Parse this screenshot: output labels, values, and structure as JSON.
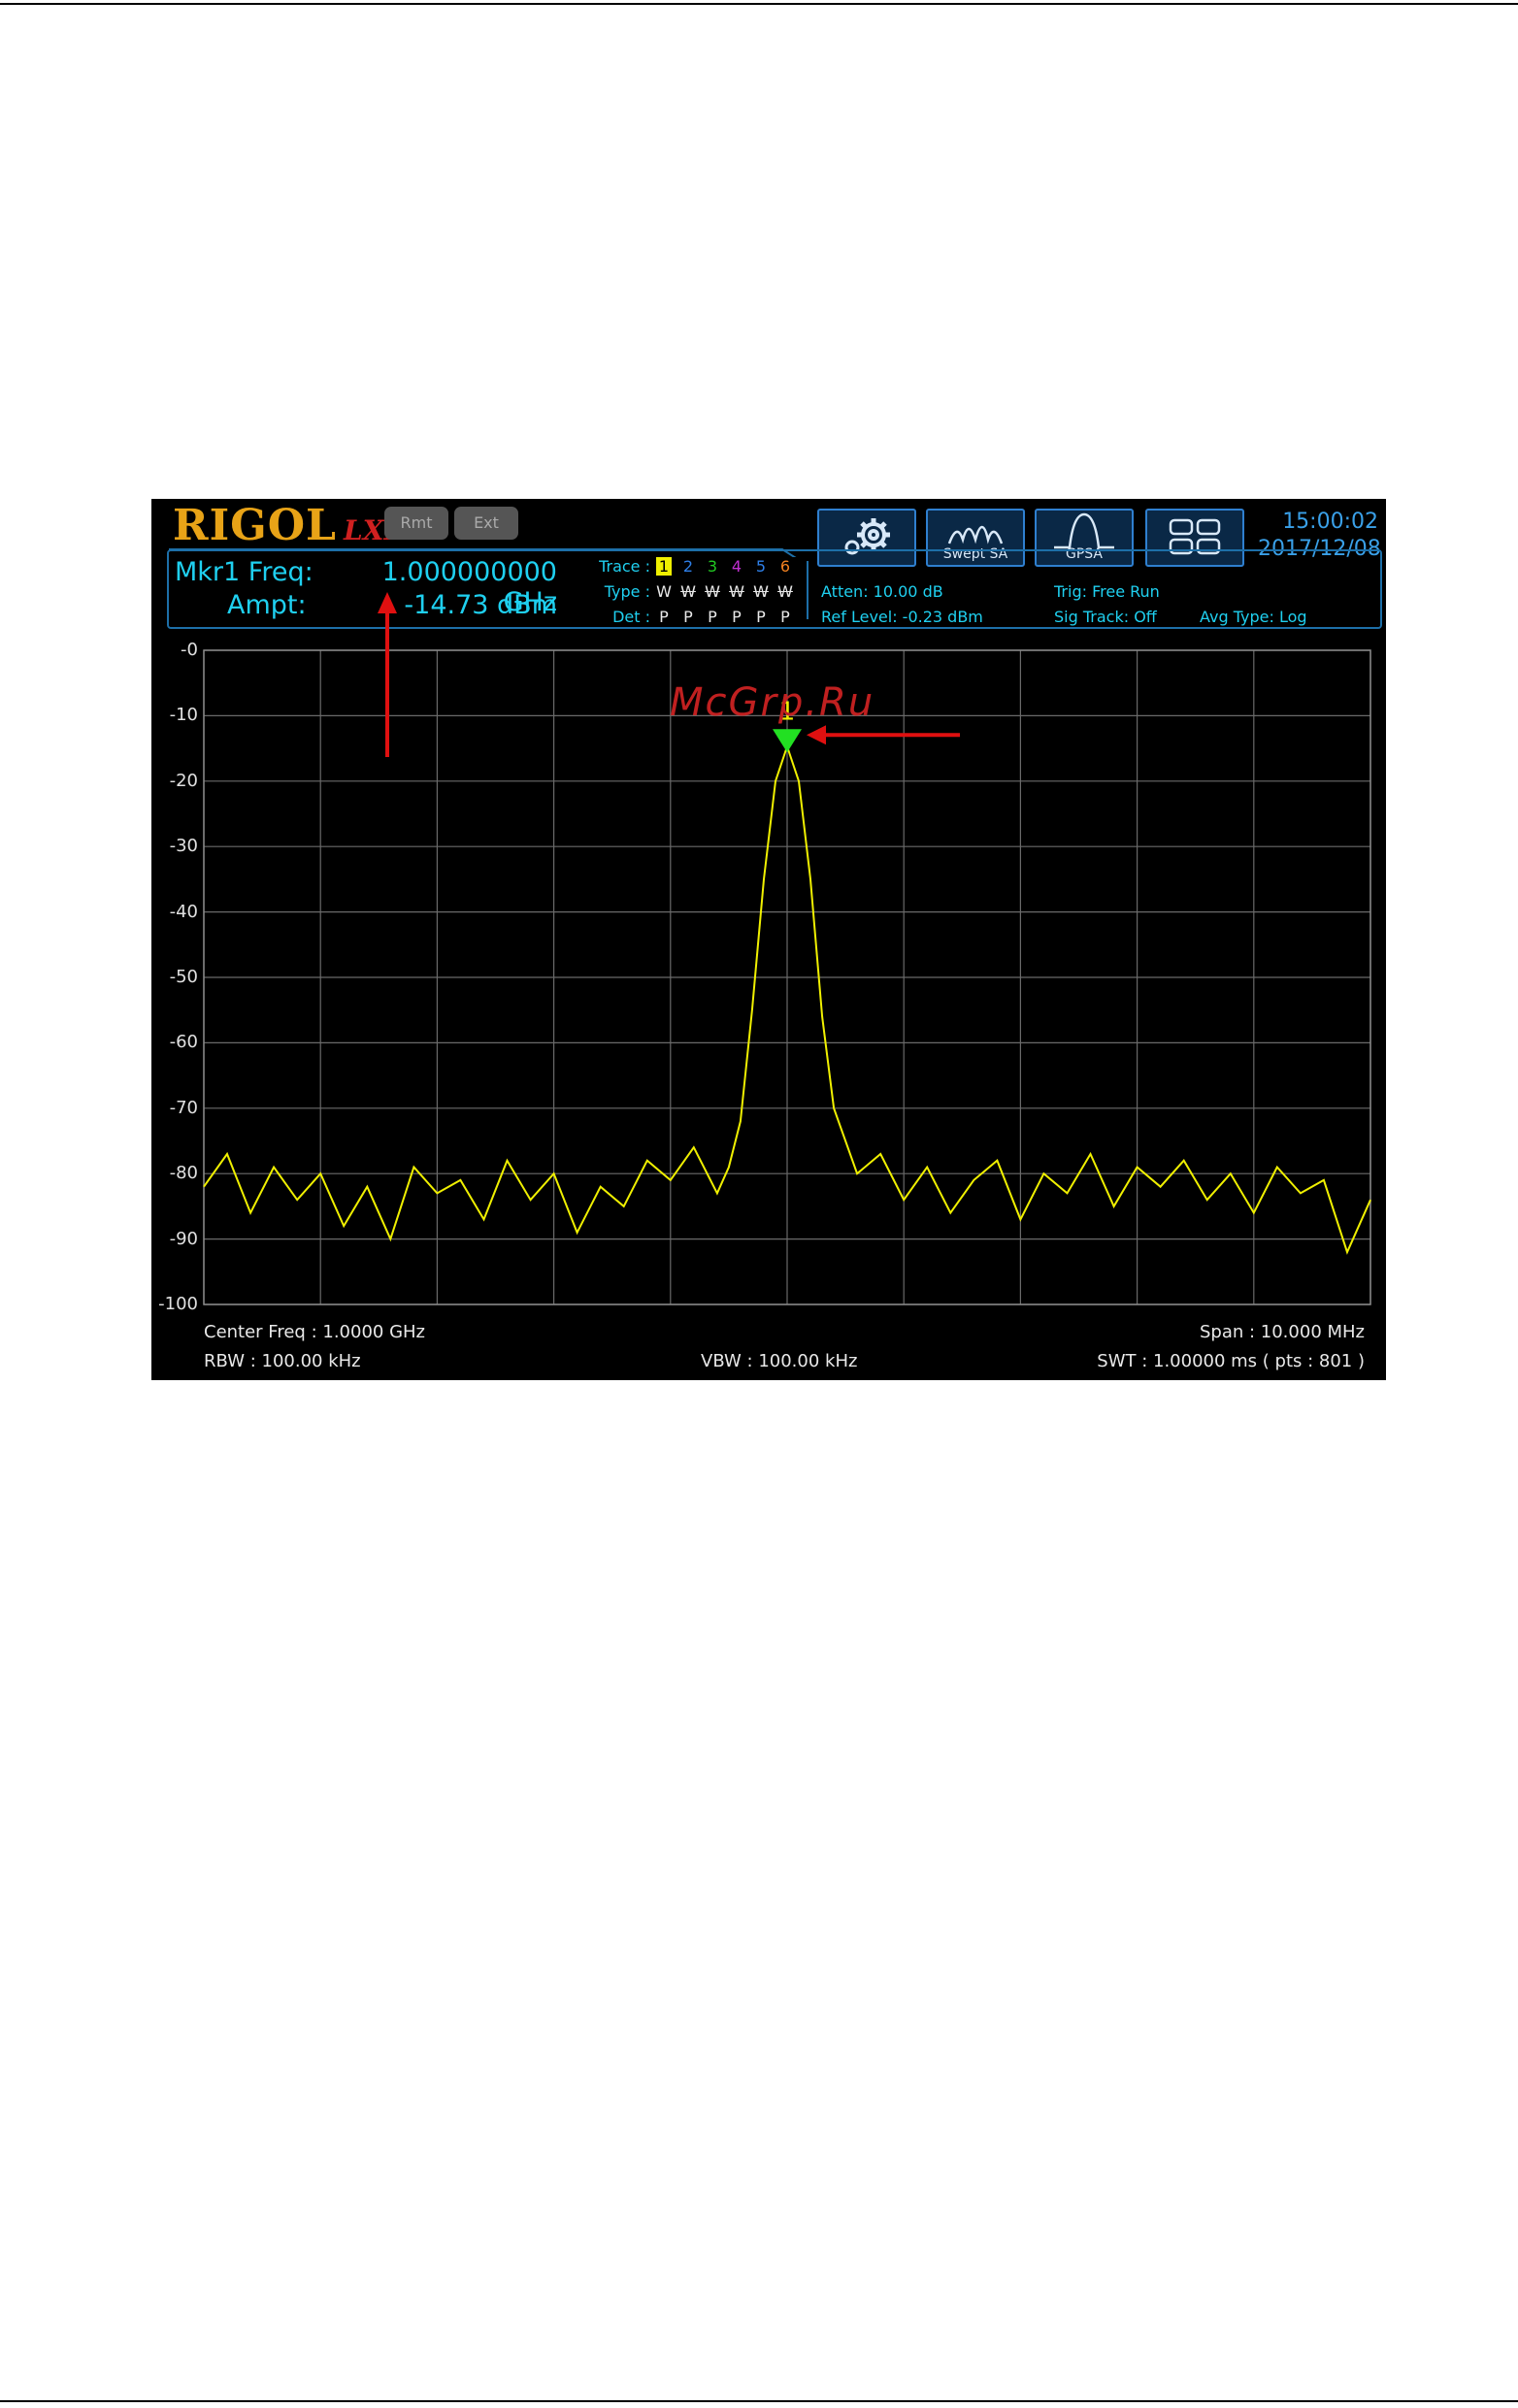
{
  "header": {
    "logo": "RIGOL",
    "logo_suffix": "LXI",
    "rmt_label": "Rmt",
    "ext_label": "Ext",
    "icons": [
      "gear-icon",
      "swept-sa-icon",
      "gpsa-icon",
      "layout-grid-icon"
    ],
    "swept_sa_label": "Swept SA",
    "gpsa_label": "GPSA",
    "time": "15:00:02",
    "date": "2017/12/08"
  },
  "marker": {
    "freq_label": "Mkr1 Freq:",
    "freq_value": "1.000000000 GHz",
    "ampt_label": "Ampt:",
    "ampt_value": "-14.73 dBm",
    "number": "1"
  },
  "traces": {
    "trace_label": "Trace :",
    "type_label": "Type :",
    "det_label": "Det :",
    "numbers": [
      "1",
      "2",
      "3",
      "4",
      "5",
      "6"
    ],
    "colors": [
      "#f0f000",
      "#2e7fe8",
      "#22c822",
      "#c02fd0",
      "#2e7fe8",
      "#f08020"
    ],
    "types": [
      "W",
      "W",
      "W",
      "W",
      "W",
      "W"
    ],
    "dets": [
      "P",
      "P",
      "P",
      "P",
      "P",
      "P"
    ]
  },
  "settings": {
    "atten": "Atten: 10.00 dB",
    "ref_level": "Ref Level: -0.23 dBm",
    "trig": "Trig: Free Run",
    "sig_track": "Sig Track: Off",
    "avg_type": "Avg Type: Log"
  },
  "footer": {
    "center_freq": "Center Freq : 1.0000 GHz",
    "span": "Span : 10.000 MHz",
    "rbw": "RBW : 100.00 kHz",
    "vbw": "VBW : 100.00 kHz",
    "swt": "SWT : 1.00000 ms ( pts : 801 )"
  },
  "watermark": "McGrp.Ru",
  "chart_data": {
    "type": "line",
    "x_range": [
      0.995,
      1.005
    ],
    "xlabel": "",
    "ylabel": "",
    "ylim": [
      -100,
      0
    ],
    "y_ticks": [
      "-0",
      "-10",
      "-20",
      "-30",
      "-40",
      "-50",
      "-60",
      "-70",
      "-80",
      "-90",
      "-100"
    ],
    "grid": true,
    "series": [
      {
        "color": "#f0f000",
        "x": [
          0.995,
          0.9952,
          0.9954,
          0.9956,
          0.9958,
          0.996,
          0.9962,
          0.9964,
          0.9966,
          0.9968,
          0.997,
          0.9972,
          0.9974,
          0.9976,
          0.9978,
          0.998,
          0.9982,
          0.9984,
          0.9986,
          0.9988,
          0.999,
          0.9992,
          0.9994,
          0.9995,
          0.9996,
          0.9997,
          0.9998,
          0.9999,
          1.0,
          1.0001,
          1.0002,
          1.0003,
          1.0004,
          1.0006,
          1.0008,
          1.001,
          1.0012,
          1.0014,
          1.0016,
          1.0018,
          1.002,
          1.0022,
          1.0024,
          1.0026,
          1.0028,
          1.003,
          1.0032,
          1.0034,
          1.0036,
          1.0038,
          1.004,
          1.0042,
          1.0044,
          1.0046,
          1.0048,
          1.005
        ],
        "values": [
          -82,
          -77,
          -86,
          -79,
          -84,
          -80,
          -88,
          -82,
          -90,
          -79,
          -83,
          -81,
          -87,
          -78,
          -84,
          -80,
          -89,
          -82,
          -85,
          -78,
          -81,
          -76,
          -83,
          -79,
          -72,
          -55,
          -35,
          -20,
          -14.7,
          -20,
          -35,
          -56,
          -70,
          -80,
          -77,
          -84,
          -79,
          -86,
          -81,
          -78,
          -87,
          -80,
          -83,
          -77,
          -85,
          -79,
          -82,
          -78,
          -84,
          -80,
          -86,
          -79,
          -83,
          -81,
          -92,
          -84
        ]
      }
    ],
    "marker": {
      "label": "1",
      "x": 1.0,
      "y": -14.73
    }
  }
}
